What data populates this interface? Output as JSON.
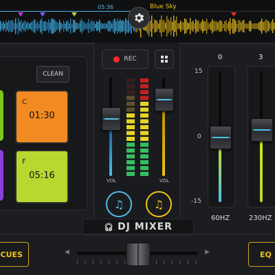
{
  "top": {
    "time": "05:36",
    "track_title": "Blue Sky",
    "progress": 0.495,
    "markers": [
      {
        "color": "#c03ad6",
        "pos": 0.075
      },
      {
        "color": "#8a5bf0",
        "pos": 0.155
      },
      {
        "color": "#b7d832",
        "pos": 0.27
      },
      {
        "color": "#ff2a2a",
        "pos": 0.85
      }
    ],
    "settings_icon": "gear-icon"
  },
  "left": {
    "clean_label": "CLEAN",
    "pads": [
      {
        "label": "C",
        "time": "01:30",
        "color": "#f28a22"
      },
      {
        "label": "F",
        "time": "05:16",
        "color": "#b6d82f"
      }
    ],
    "edge_pad_colors": [
      "#7ac91b",
      "#8b3fd9"
    ]
  },
  "center": {
    "rec_label": "REC",
    "grid_icon": "grid-icon",
    "vol_left_label": "VOL",
    "vol_right_label": "VOL",
    "vol_left_level": 0.58,
    "vol_right_level": 0.78,
    "music_left_color": "#4cc0ea",
    "music_right_color": "#f0c418"
  },
  "eq": {
    "scale_top": "15",
    "scale_mid": "0",
    "scale_bottom": "-15",
    "bands": [
      {
        "value": "0",
        "freq": "60HZ",
        "level": 0
      },
      {
        "value": "3",
        "freq": "230HZ",
        "level": 3
      }
    ]
  },
  "footer": {
    "logo_text": "DJ MIXER",
    "cues_label": "CUES",
    "eq_label": "EQ",
    "crossfader": 0.5
  },
  "colors": {
    "accent_blue": "#4cc0ea",
    "accent_yellow": "#f0c418",
    "rec_red": "#ff2b2b"
  }
}
